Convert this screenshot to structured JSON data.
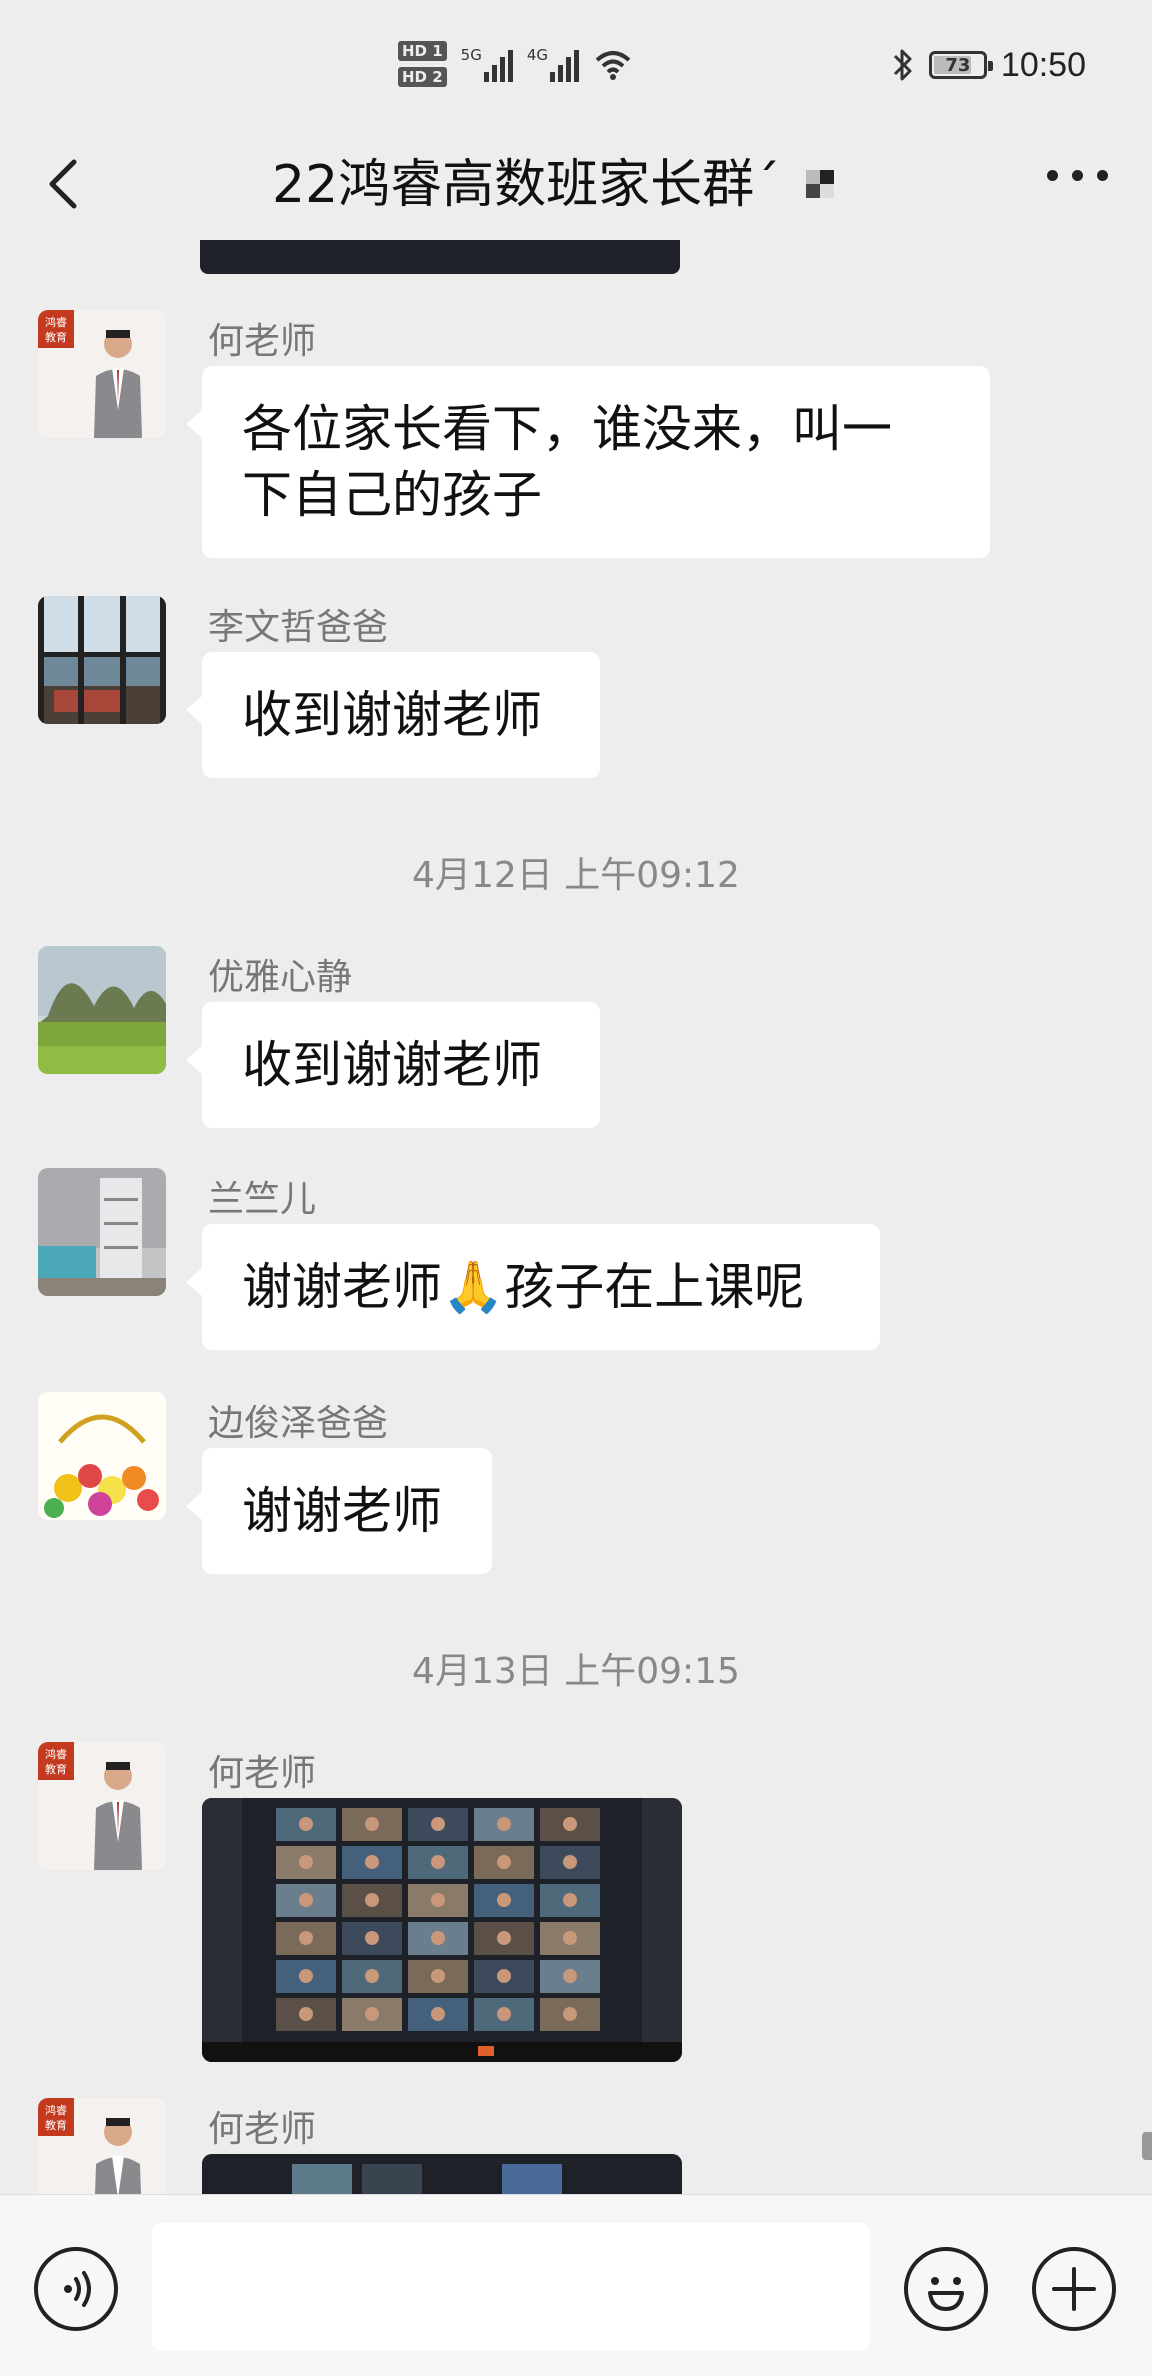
{
  "status_bar": {
    "hd1": "HD 1",
    "hd2": "HD 2",
    "net1": "5G",
    "net2": "4G",
    "battery": "73",
    "battery_level": 0.73,
    "time": "10:50"
  },
  "header": {
    "title": "22鸿睿高数班家长群´"
  },
  "messages": [
    {
      "sender": "何老师",
      "text_line1": "各位家长看下，谁没来，叫一",
      "text_line2": "下自己的孩子",
      "avatar_icon": "teacher-photo-avatar"
    },
    {
      "sender": "李文哲爸爸",
      "text": "收到谢谢老师",
      "avatar_icon": "window-view-avatar"
    },
    {
      "sender": "优雅心静",
      "text": "收到谢谢老师",
      "avatar_icon": "landscape-avatar"
    },
    {
      "sender": "兰竺儿",
      "text": "谢谢老师🙏孩子在上课呢",
      "avatar_icon": "bedroom-avatar"
    },
    {
      "sender": "边俊泽爸爸",
      "text": "谢谢老师",
      "avatar_icon": "flowers-avatar"
    },
    {
      "sender": "何老师",
      "image": "video-call-screenshot",
      "avatar_icon": "teacher-photo-avatar"
    },
    {
      "sender": "何老师",
      "image": "video-call-screenshot",
      "avatar_icon": "teacher-photo-avatar"
    }
  ],
  "timestamps": [
    "4月12日 上午09:12",
    "4月13日 上午09:15"
  ],
  "avatar_badge": "鸿睿\n教育",
  "input_bar": {
    "text_value": "",
    "voice_icon": "voice-icon",
    "emoji_icon": "emoji-icon",
    "plus_icon": "plus-icon"
  },
  "colors": {
    "background": "#ededed",
    "bubble": "#ffffff",
    "sender_text": "#777777",
    "timestamp_text": "#888888"
  }
}
